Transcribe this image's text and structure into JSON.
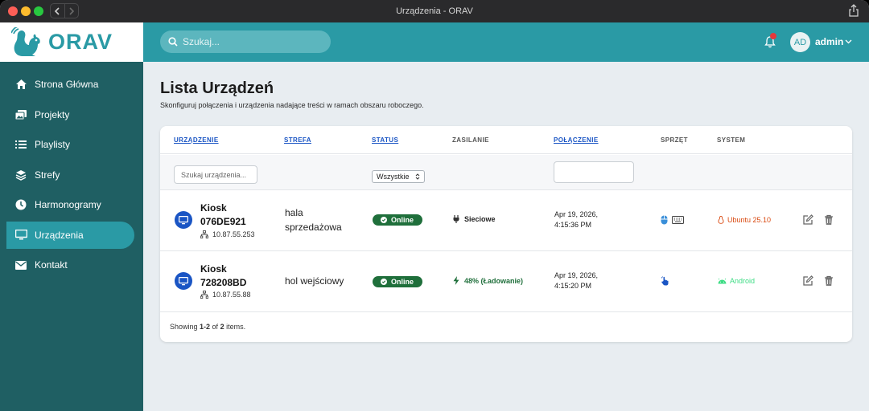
{
  "window": {
    "title": "Urządzenia - ORAV"
  },
  "logo": {
    "text": "ORAV"
  },
  "sidebar": {
    "items": [
      {
        "label": "Strona Główna",
        "icon": "home-icon"
      },
      {
        "label": "Projekty",
        "icon": "images-icon"
      },
      {
        "label": "Playlisty",
        "icon": "list-icon"
      },
      {
        "label": "Strefy",
        "icon": "layers-icon"
      },
      {
        "label": "Harmonogramy",
        "icon": "clock-icon"
      },
      {
        "label": "Urządzenia",
        "icon": "monitor-icon",
        "active": true
      },
      {
        "label": "Kontakt",
        "icon": "mail-icon"
      }
    ]
  },
  "topbar": {
    "search_placeholder": "Szukaj...",
    "user_initials": "AD",
    "user_name": "admin",
    "notification_color": "#e5383b"
  },
  "page": {
    "title": "Lista Urządzeń",
    "subtitle": "Skonfiguruj połączenia i urządzenia nadające treści w ramach obszaru roboczego."
  },
  "table": {
    "columns": {
      "device": "URZĄDZENIE",
      "zone": "STREFA",
      "status": "STATUS",
      "power": "ZASILANIE",
      "connection": "POŁĄCZENIE",
      "hardware": "SPRZĘT",
      "system": "SYSTEM"
    },
    "filters": {
      "device_placeholder": "Szukaj urządzenia...",
      "status_selected": "Wszystkie",
      "connection_value": ""
    },
    "rows": [
      {
        "name_line1": "Kiosk",
        "name_line2": "076DE921",
        "ip": "10.87.55.253",
        "zone_line1": "hala",
        "zone_line2": "sprzedażowa",
        "status": "Online",
        "power": "Sieciowe",
        "power_icon": "plug-icon",
        "connection_line1": "Apr 19, 2026,",
        "connection_line2": "4:15:36 PM",
        "hardware": [
          "mouse-icon",
          "keyboard-icon"
        ],
        "system": "Ubuntu 25.10",
        "system_icon": "linux-icon",
        "system_color": "#d9480f"
      },
      {
        "name_line1": "Kiosk",
        "name_line2": "728208BD",
        "ip": "10.87.55.88",
        "zone_line1": "hol wejściowy",
        "zone_line2": "",
        "status": "Online",
        "power": "48% (Ładowanie)",
        "power_icon": "bolt-icon",
        "connection_line1": "Apr 19, 2026,",
        "connection_line2": "4:15:20 PM",
        "hardware": [
          "touch-icon"
        ],
        "system": "Android",
        "system_icon": "android-icon",
        "system_color": "#3ddc84"
      }
    ],
    "footer": {
      "prefix": "Showing ",
      "range": "1-2",
      "middle": " of ",
      "total": "2",
      "suffix": " items."
    }
  },
  "colors": {
    "accent": "#2a9aa5",
    "sidebar": "#1f5f63",
    "link": "#1a55c4",
    "online": "#1f6f3b",
    "charging": "#1f6f3b"
  }
}
